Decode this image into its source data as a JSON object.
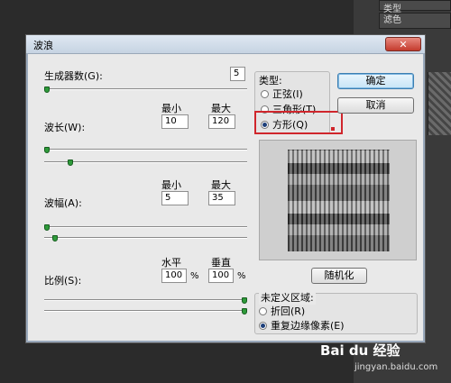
{
  "background": {
    "tab_type": "类型",
    "tab_filter": "滤色"
  },
  "dialog": {
    "title": "波浪",
    "close": "✕",
    "generators": {
      "label": "生成器数(G):",
      "value": "5",
      "slider": 0.0
    },
    "wavelength": {
      "label": "波长(W):",
      "min_header": "最小",
      "max_header": "最大",
      "min": "10",
      "max": "120",
      "slider_min": 0.0,
      "slider_max": 0.12
    },
    "amplitude": {
      "label": "波幅(A):",
      "min_header": "最小",
      "max_header": "最大",
      "min": "5",
      "max": "35",
      "slider_min": 0.0,
      "slider_max": 0.04
    },
    "scale": {
      "label": "比例(S):",
      "h_header": "水平",
      "v_header": "垂直",
      "h": "100",
      "v": "100",
      "unit": "%",
      "slider_h": 1.0,
      "slider_v": 1.0
    },
    "type_group": {
      "label": "类型:",
      "options": [
        "正弦(I)",
        "三角形(T)",
        "方形(Q)"
      ],
      "selected": 2
    },
    "buttons": {
      "ok": "确定",
      "cancel": "取消",
      "randomize": "随机化"
    },
    "undefined_area": {
      "label": "未定义区域:",
      "options": [
        "折回(R)",
        "重复边缘像素(E)"
      ],
      "selected": 1
    },
    "colors": {
      "highlight": "#d0262c",
      "slider_thumb": "#2e9a3a"
    }
  },
  "watermark": {
    "logo": "Bai du 经验",
    "url": "jingyan.baidu.com"
  }
}
